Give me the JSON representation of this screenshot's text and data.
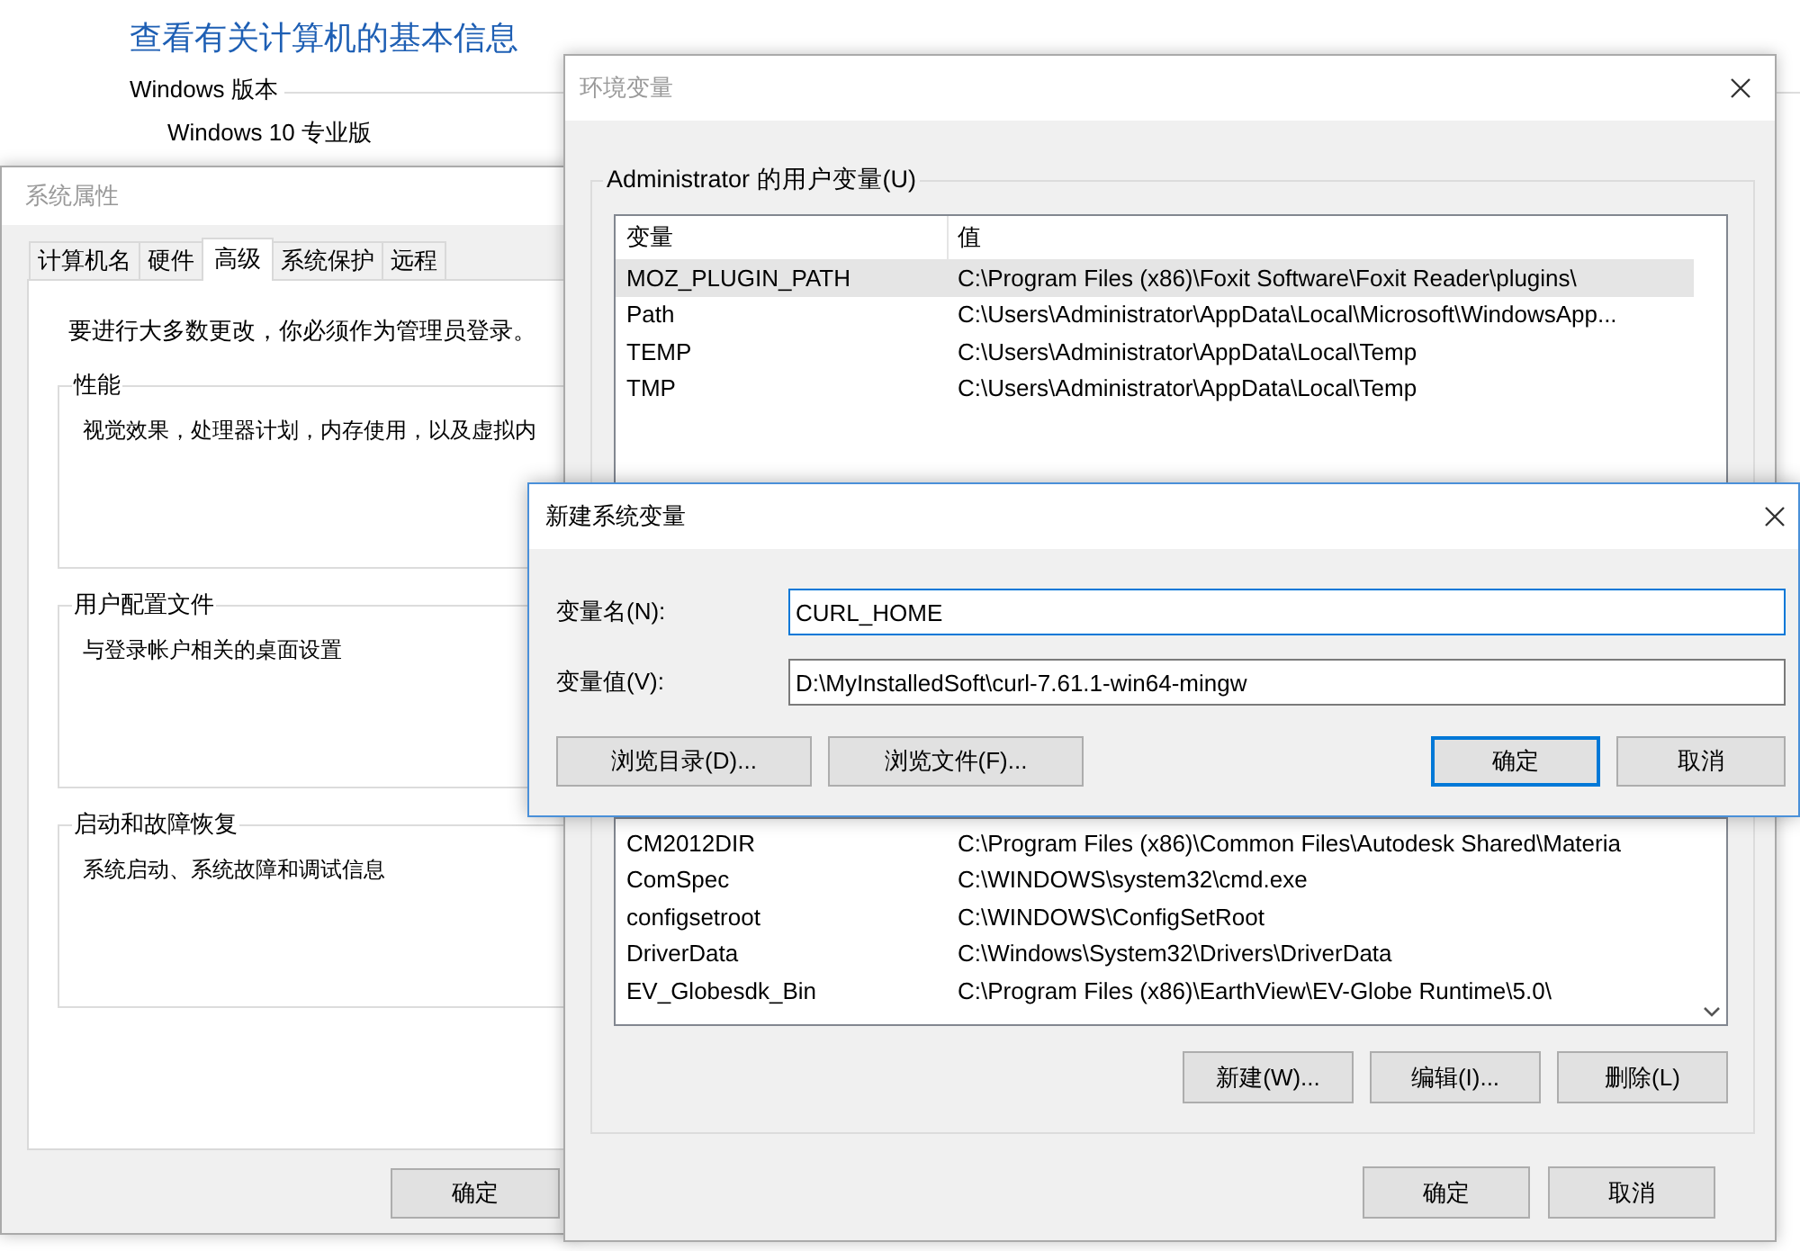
{
  "background_page": {
    "title": "查看有关计算机的基本信息",
    "section": "Windows 版本",
    "edition": "Windows 10 专业版"
  },
  "system_properties": {
    "title": "系统属性",
    "tabs": [
      {
        "label": "计算机名",
        "selected": false
      },
      {
        "label": "硬件",
        "selected": false
      },
      {
        "label": "高级",
        "selected": true
      },
      {
        "label": "系统保护",
        "selected": false
      },
      {
        "label": "远程",
        "selected": false
      }
    ],
    "notice": "要进行大多数更改，你必须作为管理员登录。",
    "groups": [
      {
        "title": "性能",
        "description": "视觉效果，处理器计划，内存使用，以及虚拟内"
      },
      {
        "title": "用户配置文件",
        "description": "与登录帐户相关的桌面设置"
      },
      {
        "title": "启动和故障恢复",
        "description": "系统启动、系统故障和调试信息"
      }
    ],
    "buttons": [
      "确定"
    ]
  },
  "environment_variables": {
    "title": "环境变量",
    "user_group": "Administrator 的用户变量(U)",
    "user_table": {
      "columns": [
        "变量",
        "值"
      ],
      "rows": [
        {
          "name": "MOZ_PLUGIN_PATH",
          "value": "C:\\Program Files (x86)\\Foxit Software\\Foxit Reader\\plugins\\",
          "selected": true
        },
        {
          "name": "Path",
          "value": "C:\\Users\\Administrator\\AppData\\Local\\Microsoft\\WindowsApp...",
          "selected": false
        },
        {
          "name": "TEMP",
          "value": "C:\\Users\\Administrator\\AppData\\Local\\Temp",
          "selected": false
        },
        {
          "name": "TMP",
          "value": "C:\\Users\\Administrator\\AppData\\Local\\Temp",
          "selected": false
        }
      ]
    },
    "system_table": {
      "rows": [
        {
          "name": "CM2012DIR",
          "value": "C:\\Program Files (x86)\\Common Files\\Autodesk Shared\\Materia"
        },
        {
          "name": "ComSpec",
          "value": "C:\\WINDOWS\\system32\\cmd.exe"
        },
        {
          "name": "configsetroot",
          "value": "C:\\WINDOWS\\ConfigSetRoot"
        },
        {
          "name": "DriverData",
          "value": "C:\\Windows\\System32\\Drivers\\DriverData"
        },
        {
          "name": "EV_Globesdk_Bin",
          "value": "C:\\Program Files (x86)\\EarthView\\EV-Globe Runtime\\5.0\\"
        }
      ]
    },
    "system_buttons": [
      "新建(W)...",
      "编辑(I)...",
      "删除(L)"
    ],
    "buttons": [
      "确定",
      "取消"
    ]
  },
  "new_variable_dialog": {
    "title": "新建系统变量",
    "fields": [
      {
        "label": "变量名(N):",
        "value": "CURL_HOME",
        "focused": true
      },
      {
        "label": "变量值(V):",
        "value": "D:\\MyInstalledSoft\\curl-7.61.1-win64-mingw",
        "focused": false
      }
    ],
    "buttons": [
      {
        "label": "浏览目录(D)...",
        "default": false
      },
      {
        "label": "浏览文件(F)...",
        "default": false
      },
      {
        "label": "确定",
        "default": true
      },
      {
        "label": "取消",
        "default": false
      }
    ]
  }
}
